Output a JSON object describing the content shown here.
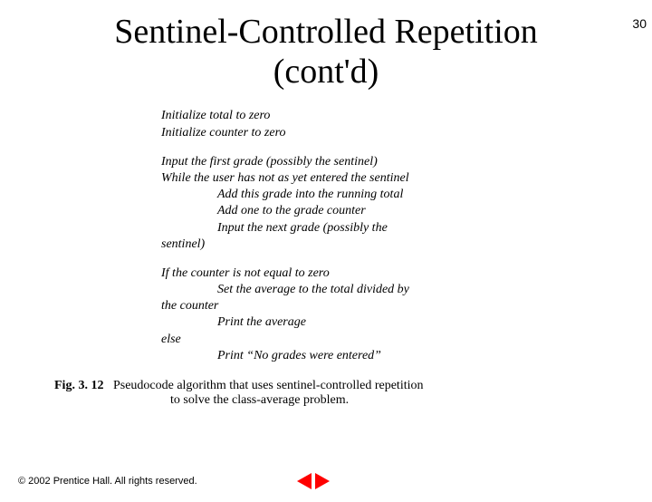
{
  "page_number": "30",
  "title_line1": "Sentinel-Controlled Repetition",
  "title_line2": "(cont'd)",
  "pseudocode": {
    "block1": {
      "l1": "Initialize total to zero",
      "l2": "Initialize counter to zero"
    },
    "block2": {
      "l1": "Input the first grade (possibly the sentinel)",
      "l2": "While the user has not as yet entered the sentinel",
      "l3": "Add this grade into the running total",
      "l4": "Add one to the grade counter",
      "l5": "Input the next grade (possibly the",
      "l6": "sentinel)"
    },
    "block3": {
      "l1": "If the counter is not equal to zero",
      "l2": "Set the average to the total divided by",
      "l3": "the counter",
      "l4": "Print the average",
      "l5": "else",
      "l6": "Print “No grades were entered”"
    }
  },
  "caption": {
    "label": "Fig. 3. 12",
    "text_l1": "Pseudocode algorithm that uses sentinel-controlled repetition",
    "text_l2": "to solve the class-average problem."
  },
  "footer": {
    "copyright": "© 2002 Prentice Hall. All rights reserved."
  },
  "icons": {
    "prev": "prev-arrow",
    "next": "next-arrow"
  }
}
